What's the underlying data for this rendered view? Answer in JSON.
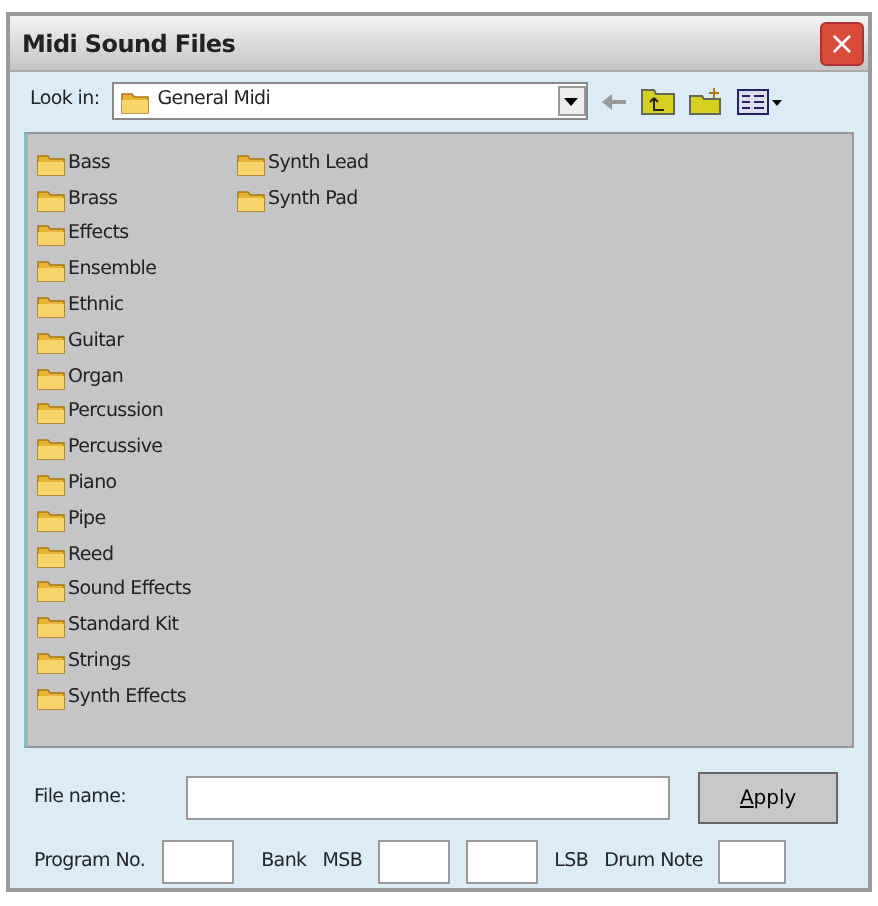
{
  "window": {
    "title": "Midi Sound Files",
    "close": "×"
  },
  "look_in": {
    "label": "Look in:",
    "value": "General Midi"
  },
  "folders": [
    {
      "name": "Bass"
    },
    {
      "name": "Brass"
    },
    {
      "name": "Effects"
    },
    {
      "name": "Ensemble"
    },
    {
      "name": "Ethnic"
    },
    {
      "name": "Guitar"
    },
    {
      "name": "Organ"
    },
    {
      "name": "Percussion"
    },
    {
      "name": "Percussive"
    },
    {
      "name": "Piano"
    },
    {
      "name": "Pipe"
    },
    {
      "name": "Reed"
    },
    {
      "name": "Sound Effects"
    },
    {
      "name": "Standard Kit"
    },
    {
      "name": "Strings"
    },
    {
      "name": "Synth Effects"
    },
    {
      "name": "Synth Lead"
    },
    {
      "name": "Synth Pad"
    }
  ],
  "file_name": {
    "label": "File name:"
  },
  "apply_button": "Apply",
  "program": {
    "label": "Program No.",
    "bank_label": "Bank",
    "msb_label": "MSB",
    "lsb_label": "LSB",
    "drum_label": "Drum Note"
  }
}
